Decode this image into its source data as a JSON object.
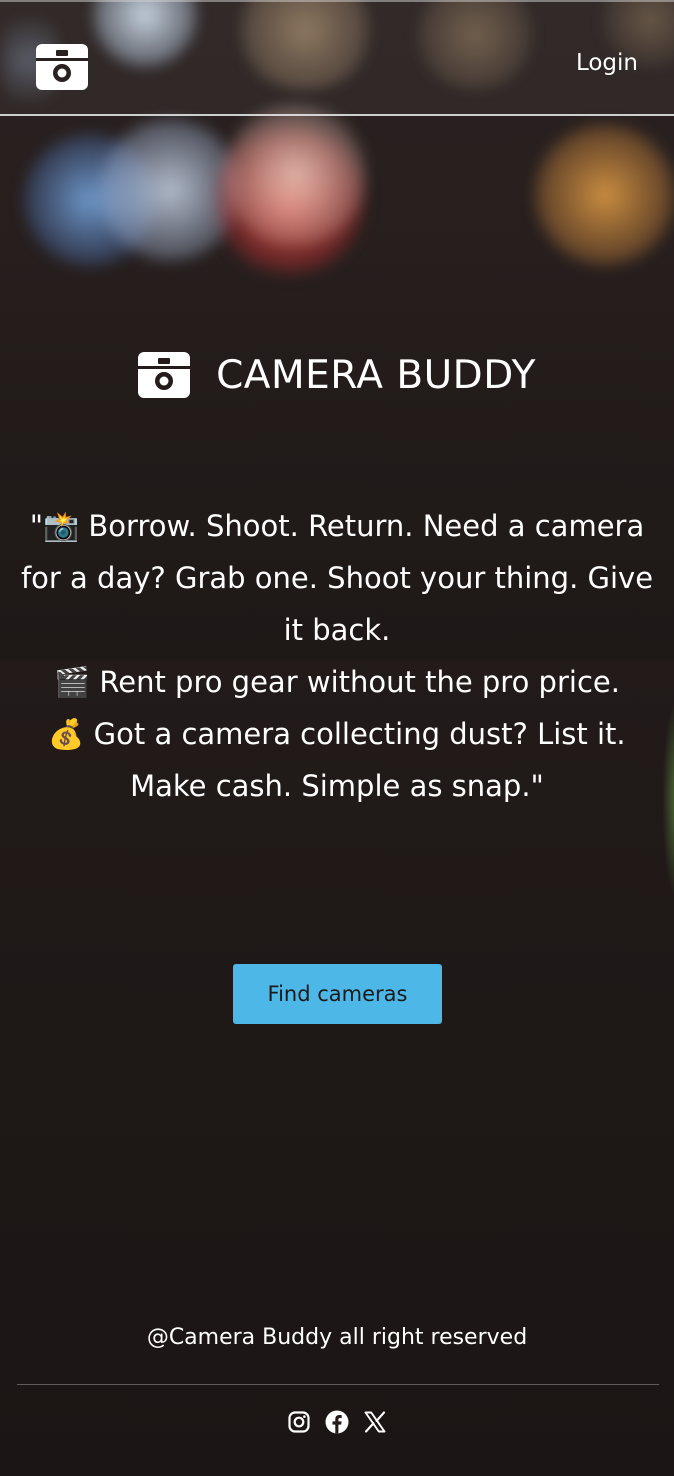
{
  "header": {
    "logo_icon": "camera-icon",
    "login_label": "Login"
  },
  "hero": {
    "brand_icon": "camera-icon",
    "brand_title": "CAMERA BUDDY",
    "tagline_lines": [
      "\"📸 Borrow. Shoot. Return. Need a camera for a day? Grab one. Shoot your thing. Give it back.",
      "🎬 Rent pro gear without the pro price.",
      "💰 Got a camera collecting dust? List it. Make cash. Simple as snap.\""
    ],
    "cta_label": "Find cameras"
  },
  "footer": {
    "copyright": "@Camera Buddy all right reserved",
    "social_icons": [
      "instagram-icon",
      "facebook-icon",
      "x-icon"
    ]
  },
  "colors": {
    "cta_background": "#4db8e8",
    "text": "#ffffff",
    "background": "#1d1716"
  }
}
